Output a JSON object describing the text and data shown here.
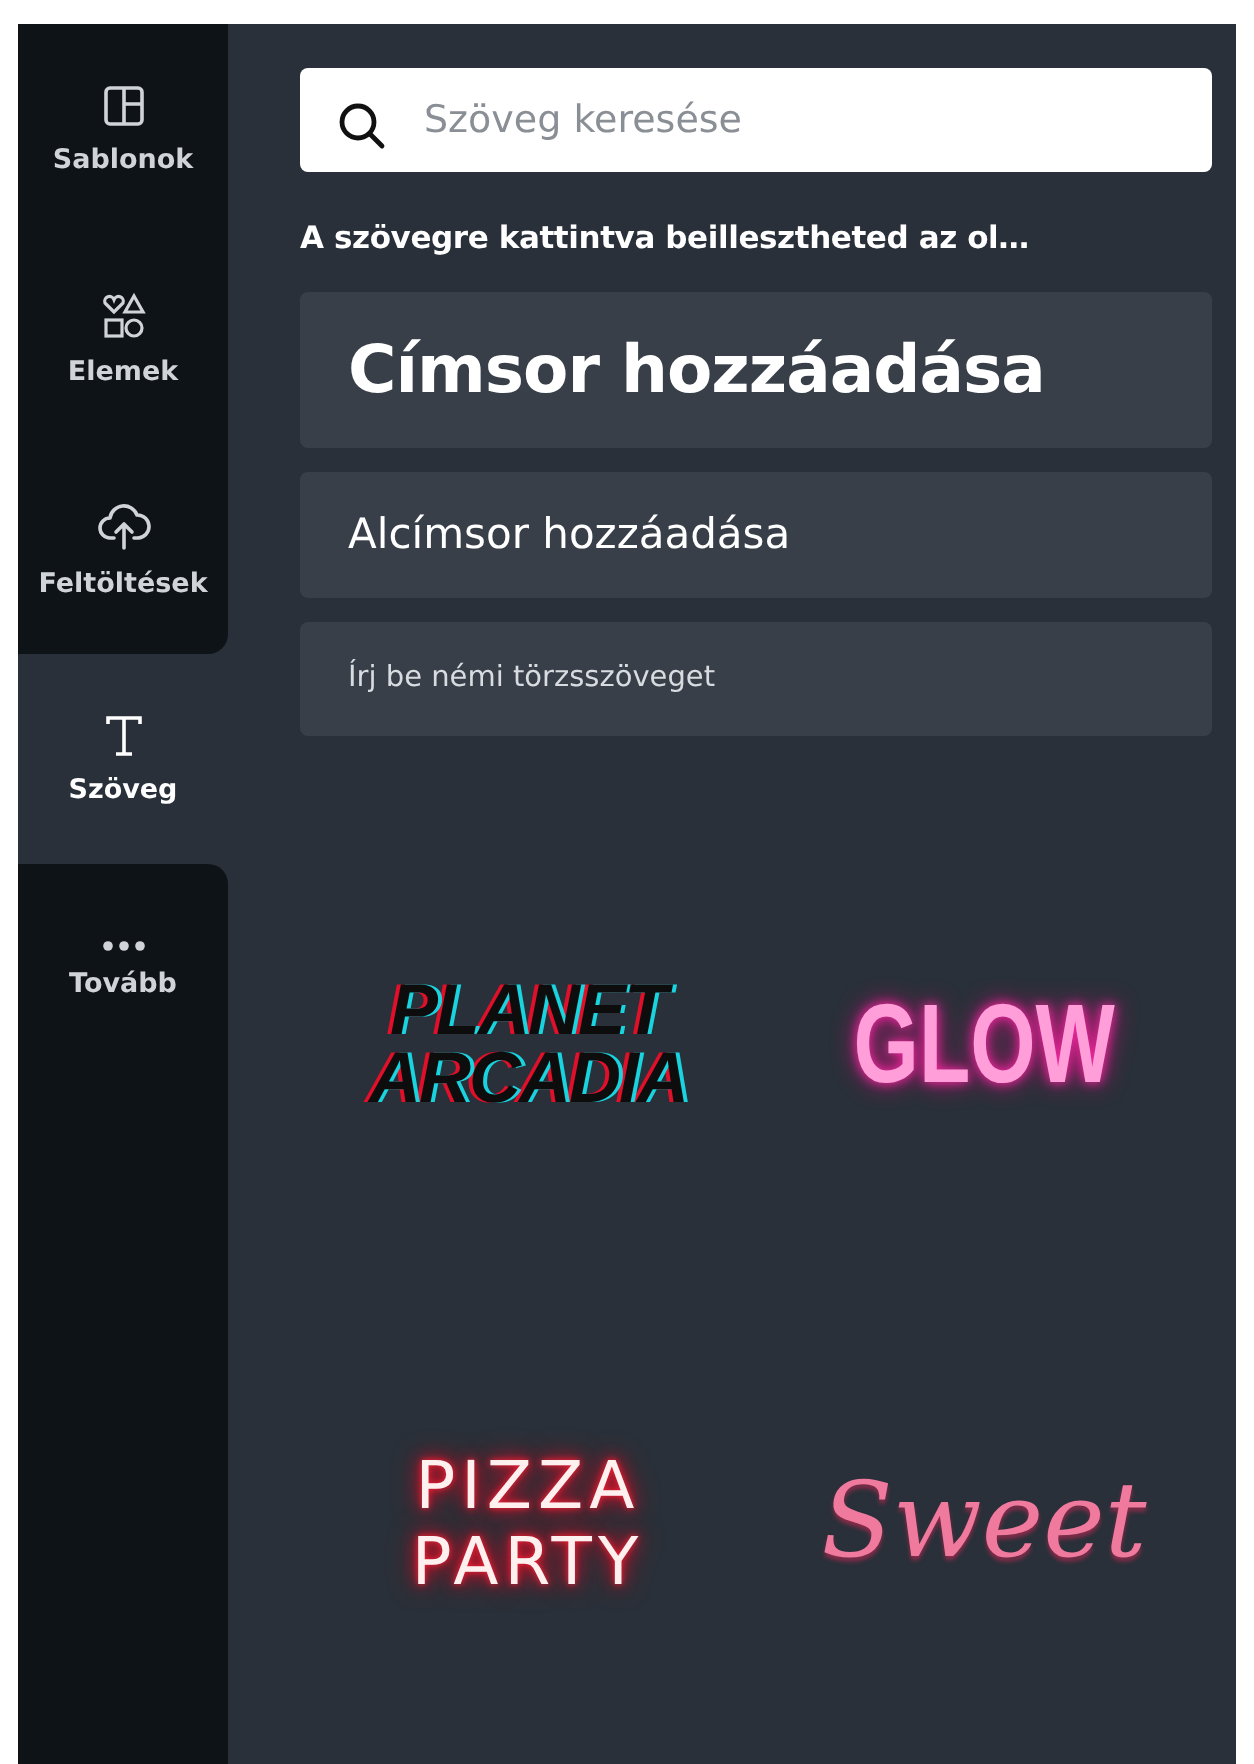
{
  "sidebar": {
    "items": [
      {
        "label": "Sablonok",
        "kind": "layout",
        "selected": false
      },
      {
        "label": "Elemek",
        "kind": "shapes",
        "selected": false
      },
      {
        "label": "Feltöltések",
        "kind": "upload",
        "selected": false
      },
      {
        "label": "Szöveg",
        "kind": "text",
        "selected": true
      },
      {
        "label": "Tovább",
        "kind": "more",
        "selected": false
      }
    ]
  },
  "search": {
    "placeholder": "Szöveg keresése"
  },
  "hint": "A szövegre kattintva beillesztheted az ol…",
  "text_buttons": [
    {
      "kind": "heading",
      "label": "Címsor hozzáadása"
    },
    {
      "kind": "subheading",
      "label": "Alcímsor hozzáadása"
    },
    {
      "kind": "body",
      "label": "Írj be némi törzsszöveget"
    }
  ],
  "effects": [
    {
      "kind": "glitch",
      "lines": [
        "PLANET",
        "ARCADIA"
      ]
    },
    {
      "kind": "glow",
      "lines": [
        "GLOW"
      ]
    },
    {
      "kind": "neon",
      "lines": [
        "PIZZA",
        "PARTY"
      ]
    },
    {
      "kind": "script",
      "lines": [
        "Sweet"
      ]
    }
  ]
}
